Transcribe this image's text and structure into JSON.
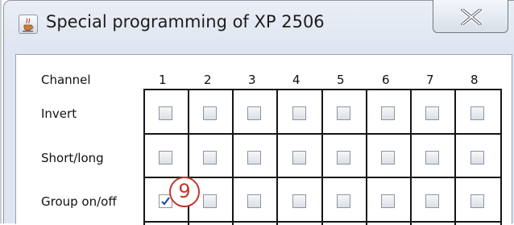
{
  "window": {
    "title": "Special programming of XP 2506",
    "app_icon": "java-cup-icon",
    "close_icon": "close-x-icon"
  },
  "grid": {
    "header_label": "Channel",
    "channels": [
      "1",
      "2",
      "3",
      "4",
      "5",
      "6",
      "7",
      "8"
    ],
    "rows": [
      {
        "label": "Invert",
        "checked": [
          false,
          false,
          false,
          false,
          false,
          false,
          false,
          false
        ]
      },
      {
        "label": "Short/long",
        "checked": [
          false,
          false,
          false,
          false,
          false,
          false,
          false,
          false
        ]
      },
      {
        "label": "Group on/off",
        "checked": [
          true,
          false,
          false,
          false,
          false,
          false,
          false,
          false
        ]
      }
    ]
  },
  "callout": {
    "text": "9",
    "color": "#c0392b"
  }
}
